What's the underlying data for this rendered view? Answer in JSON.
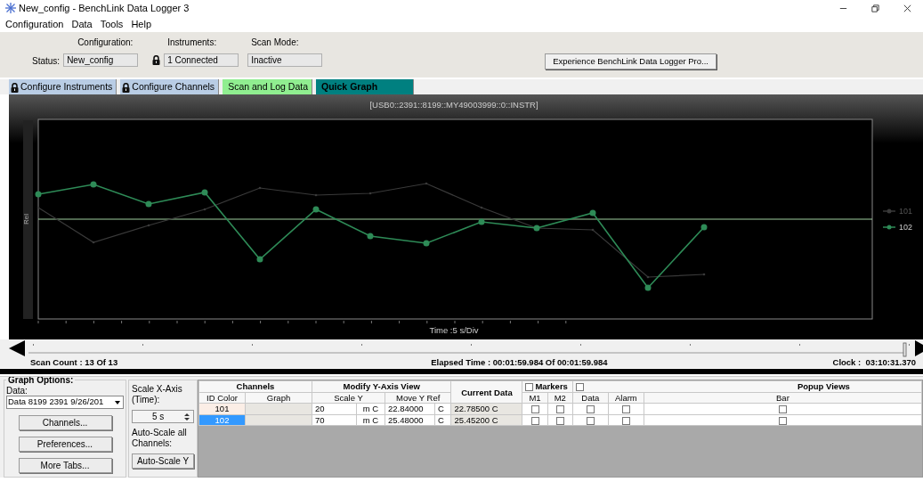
{
  "window": {
    "title": "New_config - BenchLink Data Logger 3"
  },
  "menu": [
    "Configuration",
    "Data",
    "Tools",
    "Help"
  ],
  "status_panel": {
    "status_label": "Status:",
    "fields": [
      {
        "label": "Configuration:",
        "value": "New_config"
      },
      {
        "label": "Instruments:",
        "value": "1 Connected"
      },
      {
        "label": "Scan Mode:",
        "value": "Inactive"
      }
    ],
    "configuration_locked": true,
    "button": "Experience BenchLink Data Logger Pro..."
  },
  "tabs": [
    {
      "label": "Configure Instruments",
      "locked": true,
      "color": "#b9cde5",
      "selected": false
    },
    {
      "label": "Configure Channels",
      "locked": true,
      "color": "#b9cde5",
      "selected": false
    },
    {
      "label": "Scan and Log Data",
      "locked": false,
      "color": "#90ee90",
      "selected": false
    },
    {
      "label": "Quick Graph",
      "locked": false,
      "color": "#008080",
      "selected": true
    }
  ],
  "graph": {
    "title": "[USB0::2391::8199::MY49003999::0::INSTR]",
    "y_label": "Rel",
    "x_label": "Time :5 s/Div",
    "legend": [
      {
        "label": "101",
        "color": "#3a3a3a"
      },
      {
        "label": "102",
        "color": "#2e8b57"
      }
    ]
  },
  "timeline": {
    "level": 1
  },
  "scan_bar": {
    "scan_count": "Scan Count : 13 Of 13",
    "elapsed": "Elapsed Time : 00:01:59.984 Of 00:01:59.984",
    "clock": "Clock :  03:10:31.370"
  },
  "graph_options": {
    "title": "Graph Options:",
    "data_label": "Data:",
    "data_value": "Data 8199 2391 9/26/201",
    "buttons": [
      "Channels...",
      "Preferences...",
      "More Tabs..."
    ]
  },
  "scale_panel": {
    "x_label": "Scale X-Axis (Time):",
    "x_value": "5 s",
    "auto_label": "Auto-Scale all Channels:",
    "auto_button": "Auto-Scale Y"
  },
  "table": {
    "groups": {
      "channels": "Channels",
      "modify": "Modify Y-Axis View",
      "current": "Current Data",
      "markers": "Markers",
      "markers_checked": false,
      "popup": "Popup Views",
      "popup_checked": false
    },
    "columns": [
      "ID Color",
      "Graph",
      "Scale Y",
      "Move Y Ref",
      "M1",
      "M2",
      "Data",
      "Alarm",
      "Bar"
    ],
    "rows": [
      {
        "id": "101",
        "selected": false,
        "scale": "20",
        "scale_unit": "m C",
        "move": "22.84000",
        "move_unit": "C",
        "current": "22.78500 C",
        "m1": false,
        "m2": false,
        "data": false,
        "alarm": false,
        "bar": false
      },
      {
        "id": "102",
        "selected": true,
        "scale": "70",
        "scale_unit": "m C",
        "move": "25.48000",
        "move_unit": "C",
        "current": "25.45200 C",
        "m1": false,
        "m2": false,
        "data": false,
        "alarm": false,
        "bar": false
      }
    ]
  }
}
